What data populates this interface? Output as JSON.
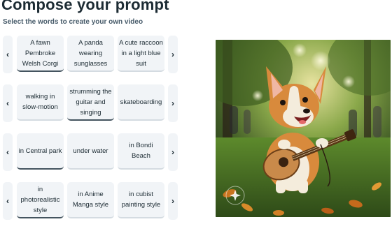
{
  "header": {
    "title": "Compose your prompt",
    "subtitle": "Select the words to create your own video"
  },
  "rows": [
    {
      "name": "subject",
      "options": [
        {
          "label": "A fawn Pembroke Welsh Corgi",
          "selected": true
        },
        {
          "label": "A panda wearing sunglasses",
          "selected": false
        },
        {
          "label": "A cute raccoon in a light blue suit",
          "selected": false
        }
      ]
    },
    {
      "name": "action",
      "options": [
        {
          "label": "walking in slow-motion",
          "selected": false
        },
        {
          "label": "strumming the guitar and singing",
          "selected": true
        },
        {
          "label": "skateboarding",
          "selected": false
        }
      ]
    },
    {
      "name": "location",
      "options": [
        {
          "label": "in Central park",
          "selected": true
        },
        {
          "label": "under water",
          "selected": false
        },
        {
          "label": "in Bondi Beach",
          "selected": false
        }
      ]
    },
    {
      "name": "style",
      "options": [
        {
          "label": "in photorealistic style",
          "selected": true
        },
        {
          "label": "in Anime Manga style",
          "selected": false
        },
        {
          "label": "in cubist painting style",
          "selected": false
        }
      ]
    }
  ],
  "arrows": {
    "prev": "‹",
    "next": "›"
  },
  "colors": {
    "card_bg": "#f1f4f7",
    "card_selected_underline": "#44545f",
    "title": "#1c2b33",
    "subtitle": "#465a69"
  }
}
